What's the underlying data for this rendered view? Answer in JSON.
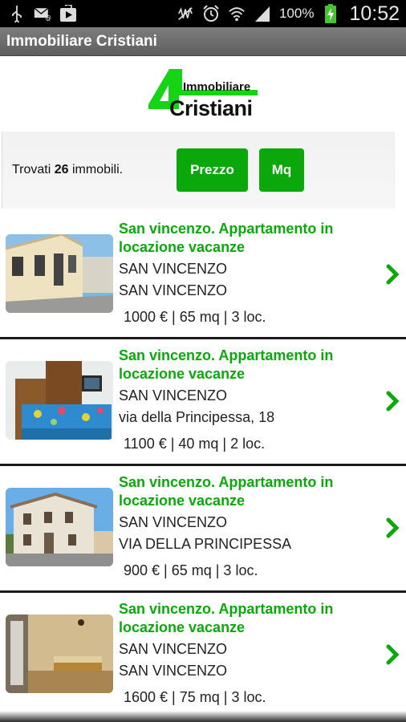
{
  "status_bar": {
    "battery_percent": "100%",
    "time": "10:52",
    "icons": [
      "usb-icon",
      "mail-icon",
      "play-store-icon",
      "mute-vibrate-icon",
      "alarm-icon",
      "wifi-icon",
      "signal-icon",
      "battery-charging-icon"
    ]
  },
  "action_bar": {
    "title": "Immobiliare Cristiani"
  },
  "logo": {
    "line1": "Immobiliare",
    "line2": "Cristiani"
  },
  "filter": {
    "found_prefix": "Trovati ",
    "found_count": "26",
    "found_suffix": " immobili.",
    "price_button": "Prezzo",
    "area_button": "Mq"
  },
  "colors": {
    "accent_green": "#0aa80a",
    "action_bar": "#6b6b6b"
  },
  "listings": [
    {
      "title": "San vincenzo. Appartamento in locazione vacanze",
      "city": "SAN VINCENZO",
      "address": "SAN VINCENZO",
      "details": "1000 € | 65 mq | 3 loc."
    },
    {
      "title": "San vincenzo. Appartamento in locazione vacanze",
      "city": "SAN VINCENZO",
      "address": "via della Principessa, 18",
      "details": "1100 € | 40 mq | 2 loc."
    },
    {
      "title": "San vincenzo. Appartamento in locazione vacanze",
      "city": "SAN VINCENZO",
      "address": "VIA DELLA PRINCIPESSA",
      "details": "900 € | 65 mq | 3 loc."
    },
    {
      "title": "San vincenzo. Appartamento in locazione vacanze",
      "city": "SAN VINCENZO",
      "address": "SAN VINCENZO",
      "details": "1600 € | 75 mq | 3 loc."
    }
  ]
}
